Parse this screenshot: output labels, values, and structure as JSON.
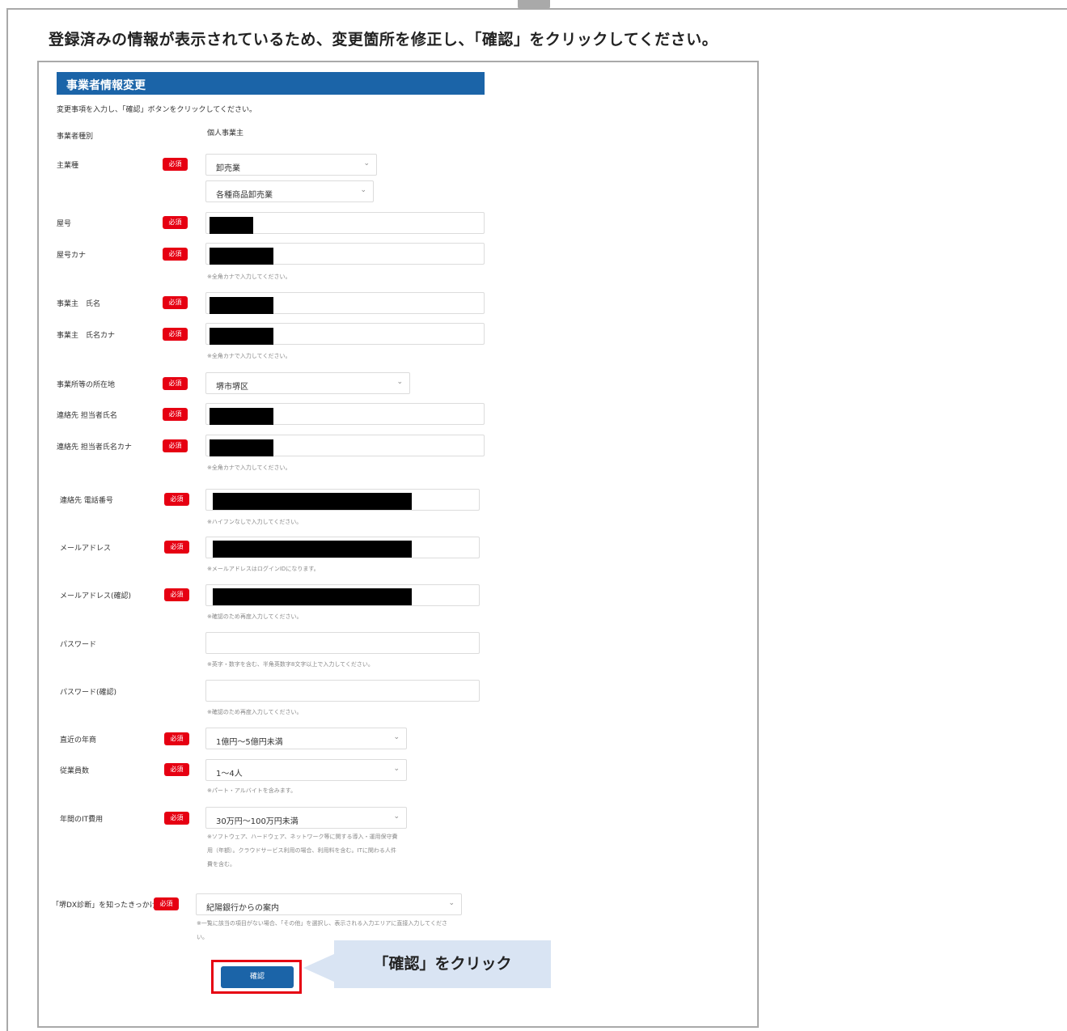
{
  "instruction": "登録済みの情報が表示されているため、変更箇所を修正し、「確認」をクリックしてください。",
  "form": {
    "title": "事業者情報変更",
    "lead": "変更事項を入力し、「確認」ボタンをクリックしてください。",
    "required_label": "必須",
    "business_type": {
      "label": "事業者種別",
      "value": "個人事業主"
    },
    "main_industry": {
      "label": "主業種",
      "value1": "卸売業",
      "value2": "各種商品卸売業"
    },
    "trade_name": {
      "label": "屋号"
    },
    "trade_name_kana": {
      "label": "屋号カナ",
      "note": "※全角カナで入力してください。"
    },
    "owner_name": {
      "label": "事業主　氏名"
    },
    "owner_name_kana": {
      "label": "事業主　氏名カナ",
      "note": "※全角カナで入力してください。"
    },
    "location": {
      "label": "事業所等の所在地",
      "value": "堺市堺区"
    },
    "contact_name": {
      "label": "連絡先 担当者氏名"
    },
    "contact_name_kana": {
      "label": "連絡先 担当者氏名カナ",
      "note": "※全角カナで入力してください。"
    },
    "phone": {
      "label": "連絡先 電話番号",
      "note": "※ハイフンなしで入力してください。"
    },
    "email": {
      "label": "メールアドレス",
      "note": "※メールアドレスはログインIDになります。"
    },
    "email_confirm": {
      "label": "メールアドレス(確認)",
      "note": "※確認のため再度入力してください。"
    },
    "password": {
      "label": "パスワード",
      "note": "※英字・数字を含む、半角英数字8文字以上で入力してください。"
    },
    "password_confirm": {
      "label": "パスワード(確認)",
      "note": "※確認のため再度入力してください。"
    },
    "revenue": {
      "label": "直近の年商",
      "value": "1億円～5億円未満"
    },
    "employees": {
      "label": "従業員数",
      "value": "1～4人",
      "note": "※パート・アルバイトを含みます。"
    },
    "it_cost": {
      "label": "年間のIT費用",
      "value": "30万円～100万円未満",
      "note_lines": [
        "※ソフトウェア、ハードウェア、ネットワーク等に関する導入・運用保守費",
        "用（年額）。クラウドサービス利用の場合、利用料を含む。ITに関わる人件",
        "費を含む。"
      ]
    },
    "source": {
      "label": "「堺DX診断」を知ったきっかけ",
      "value": "紀陽銀行からの案内",
      "note_lines": [
        "※一覧に該当の項目がない場合、「その他」を選択し、表示される入力エリアに直接入力してくださ",
        "い。"
      ]
    },
    "confirm_button": "確認"
  },
  "callout": "「確認」をクリック",
  "icons": {
    "chevron": "chevron-down-icon"
  },
  "colors": {
    "header_blue": "#1b64a8",
    "required_red": "#e60012",
    "callout_bg": "#d9e4f3"
  }
}
